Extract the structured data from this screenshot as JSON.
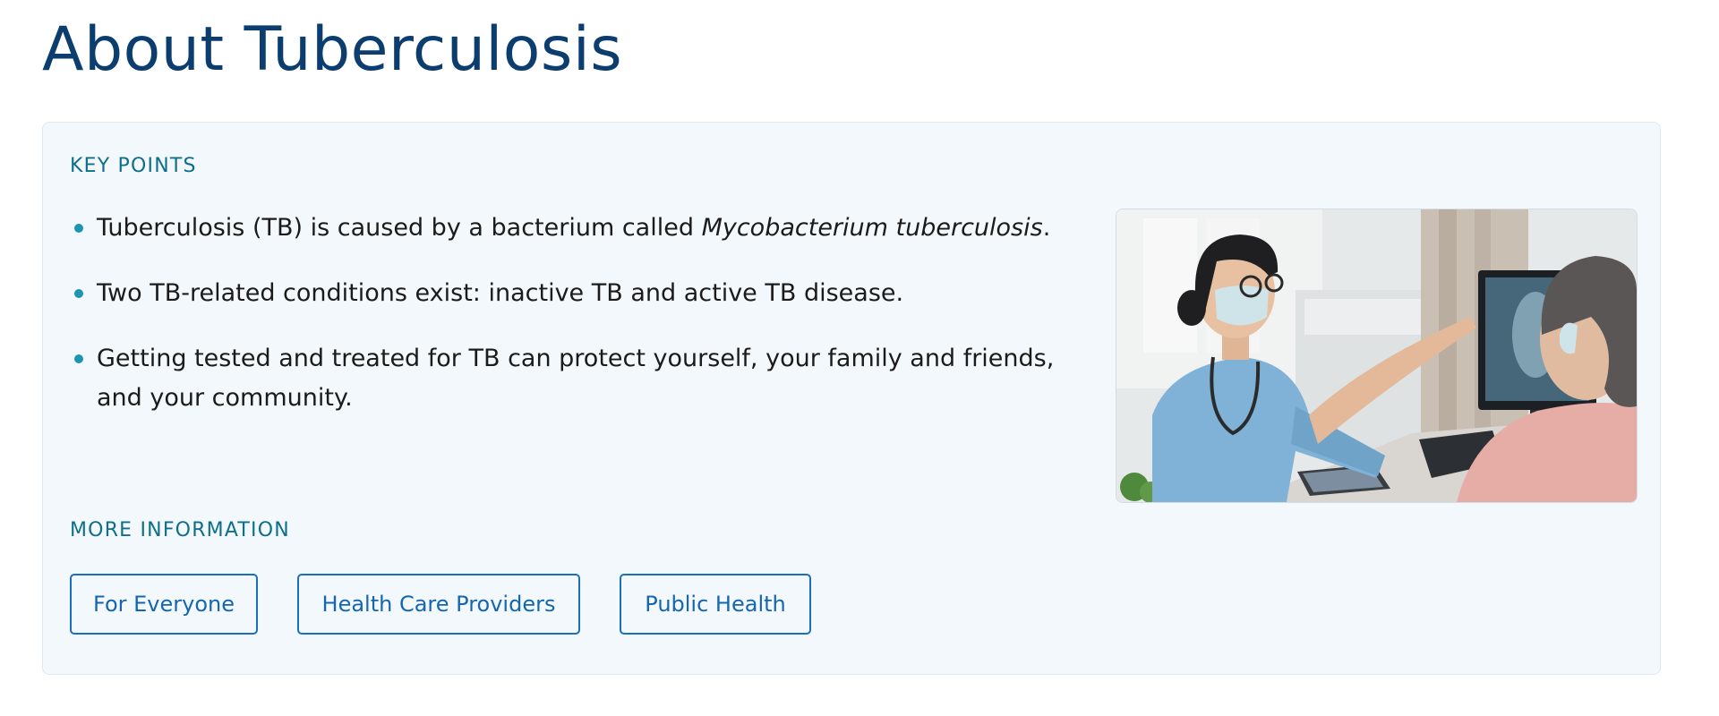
{
  "page": {
    "title": "About Tuberculosis"
  },
  "key_points": {
    "heading": "KEY POINTS",
    "items": [
      {
        "text": "Tuberculosis (TB) is caused by a bacterium called ",
        "italic": "Mycobacterium tuberculosis",
        "suffix": "."
      },
      {
        "text": "Two TB-related conditions exist: inactive TB and active TB disease."
      },
      {
        "text": "Getting tested and treated for TB can protect yourself, your family and friends, and your community."
      }
    ]
  },
  "image": {
    "icon": "doctor-patient-xray-photo"
  },
  "more_information": {
    "heading": "MORE INFORMATION",
    "buttons": [
      {
        "label": "For Everyone"
      },
      {
        "label": "Health Care Providers"
      },
      {
        "label": "Public Health"
      }
    ]
  },
  "colors": {
    "title": "#0b3d6e",
    "heading": "#0f6f8a",
    "bullet": "#1a96b4",
    "button": "#1566b0",
    "card_bg": "#f3f8fc"
  }
}
